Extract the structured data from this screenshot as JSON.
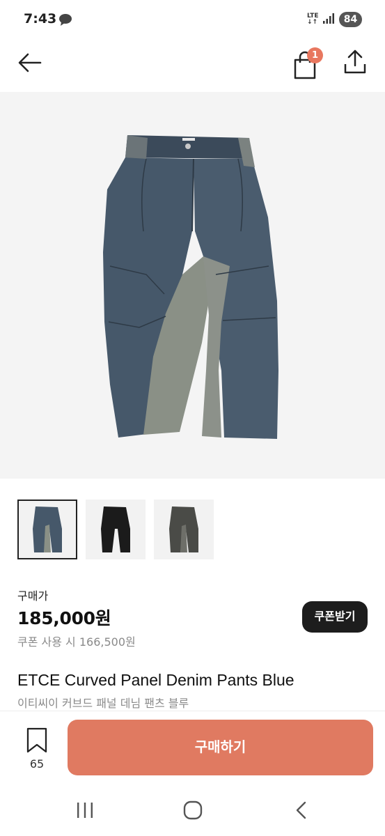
{
  "status": {
    "time": "7:43",
    "network": "LTE",
    "battery": "84"
  },
  "header": {
    "cart_count": "1"
  },
  "icons": {
    "back": "arrow-left-icon",
    "cart": "shopping-bag-icon",
    "share": "share-upload-icon",
    "bookmark": "bookmark-icon"
  },
  "gallery": {
    "thumbnails": [
      {
        "color": "blue denim",
        "selected": true
      },
      {
        "color": "black",
        "selected": false
      },
      {
        "color": "gray washed",
        "selected": false
      }
    ]
  },
  "product": {
    "price_label": "구매가",
    "price": "185,000원",
    "coupon_price": "쿠폰 사용 시 166,500원",
    "coupon_button": "쿠폰받기",
    "title": "ETCE Curved Panel Denim Pants Blue",
    "subtitle": "이티씨이 커브드 패널 데님 팬츠 블루"
  },
  "bottom_bar": {
    "bookmark_count": "65",
    "buy_button": "구매하기"
  },
  "colors": {
    "accent": "#e07a61",
    "badge": "#e8775f",
    "dark_button": "#1d1d1d",
    "muted_text": "#8a8a8a"
  }
}
